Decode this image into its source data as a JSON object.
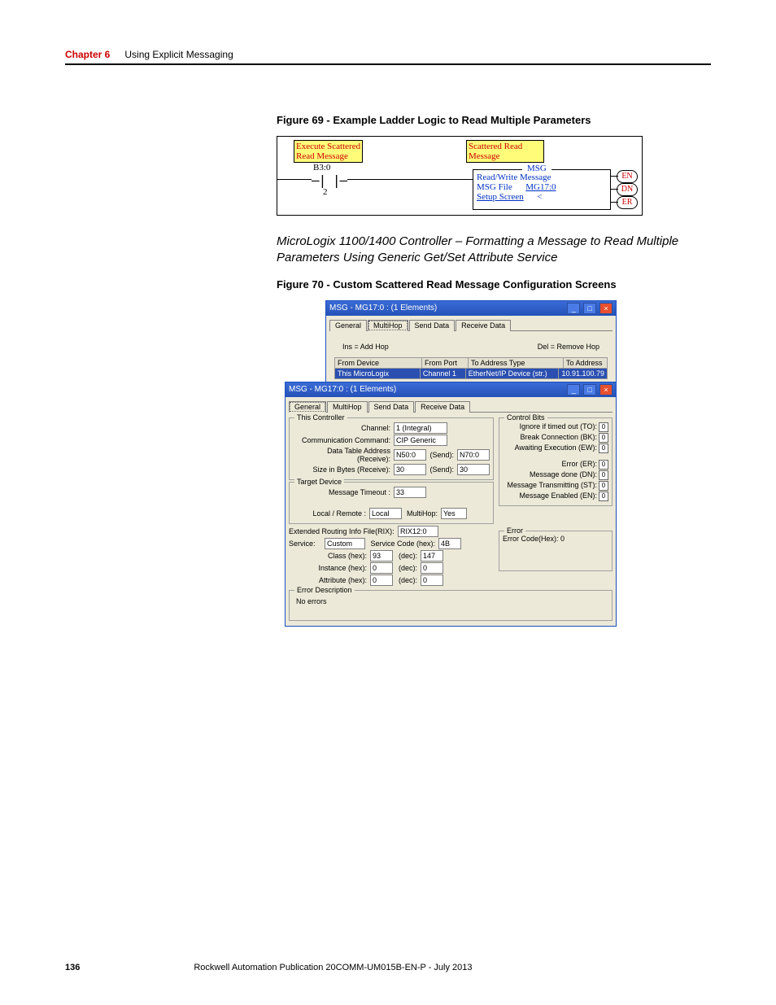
{
  "header": {
    "chapter": "Chapter 6",
    "title": "Using Explicit Messaging"
  },
  "fig69": {
    "caption": "Figure 69 - Example Ladder Logic to Read Multiple Parameters",
    "note_left_l1": "Execute Scattered",
    "note_left_l2": "Read Message",
    "note_right_l1": "Scattered Read",
    "note_right_l2": "Message",
    "contact_addr": "B3:0",
    "contact_bit": "2",
    "msg_title": "MSG",
    "msg_line1": "Read/Write Message",
    "msg_line2a": "MSG File",
    "msg_line2b": "MG17:0",
    "msg_line3a": "Setup Screen",
    "msg_line3b": "<",
    "out_en": "EN",
    "out_dn": "DN",
    "out_er": "ER"
  },
  "caption_italic": "MicroLogix 1100/1400 Controller – Formatting a Message to Read Multiple Parameters Using Generic Get/Set Attribute Service",
  "fig70": {
    "caption": "Figure 70 - Custom Scattered Read Message Configuration Screens"
  },
  "win_multihop": {
    "title": "MSG - MG17:0 : (1 Elements)",
    "tabs": [
      "General",
      "MultiHop",
      "Send Data",
      "Receive Data"
    ],
    "hint_ins": "Ins = Add Hop",
    "hint_del": "Del = Remove Hop",
    "cols": [
      "From Device",
      "From Port",
      "To Address Type",
      "To Address"
    ],
    "row": [
      "This MicroLogix",
      "Channel 1",
      "EtherNet/IP Device (str.)",
      "10.91.100.79"
    ]
  },
  "win_general": {
    "title": "MSG - MG17:0 : (1 Elements)",
    "tabs": [
      "General",
      "MultiHop",
      "Send Data",
      "Receive Data"
    ],
    "this_controller": "This Controller",
    "channel_lbl": "Channel:",
    "channel_val": "1 (Integral)",
    "comm_cmd_lbl": "Communication Command:",
    "comm_cmd_val": "CIP Generic",
    "dt_recv_lbl": "Data Table Address (Receive):",
    "dt_recv_val": "N50:0",
    "send1_lbl": "(Send):",
    "send1_val": "N70:0",
    "size_recv_lbl": "Size in Bytes (Receive):",
    "size_recv_val": "30",
    "send2_lbl": "(Send):",
    "send2_val": "30",
    "target": "Target Device",
    "timeout_lbl": "Message Timeout :",
    "timeout_val": "33",
    "local_lbl": "Local / Remote :",
    "local_val": "Local",
    "multihop_lbl": "MultiHop:",
    "multihop_val": "Yes",
    "ext_route_lbl": "Extended Routing Info File(RIX):",
    "ext_route_val": "RIX12:0",
    "service_lbl": "Service:",
    "service_val": "Custom",
    "svc_code_lbl": "Service Code (hex):",
    "svc_code_val": "4B",
    "class_hex_lbl": "Class (hex):",
    "class_hex_val": "93",
    "class_dec_lbl": "(dec):",
    "class_dec_val": "147",
    "inst_hex_lbl": "Instance (hex):",
    "inst_hex_val": "0",
    "inst_dec_lbl": "(dec):",
    "inst_dec_val": "0",
    "attr_hex_lbl": "Attribute (hex):",
    "attr_hex_val": "0",
    "attr_dec_lbl": "(dec):",
    "attr_dec_val": "0",
    "control_bits": "Control Bits",
    "cb_to": "Ignore if timed out (TO):",
    "cb_bk": "Break Connection (BK):",
    "cb_ew": "Awaiting Execution (EW):",
    "cb_er": "Error (ER):",
    "cb_dn": "Message done (DN):",
    "cb_st": "Message Transmitting (ST):",
    "cb_en": "Message Enabled (EN):",
    "cb_to_v": "0",
    "cb_bk_v": "0",
    "cb_ew_v": "0",
    "cb_er_v": "0",
    "cb_dn_v": "0",
    "cb_st_v": "0",
    "cb_en_v": "0",
    "error_grp": "Error",
    "error_code": "Error Code(Hex): 0",
    "error_desc_grp": "Error Description",
    "error_desc": "No errors"
  },
  "footer": {
    "page": "136",
    "pub": "Rockwell Automation Publication 20COMM-UM015B-EN-P - July 2013"
  }
}
